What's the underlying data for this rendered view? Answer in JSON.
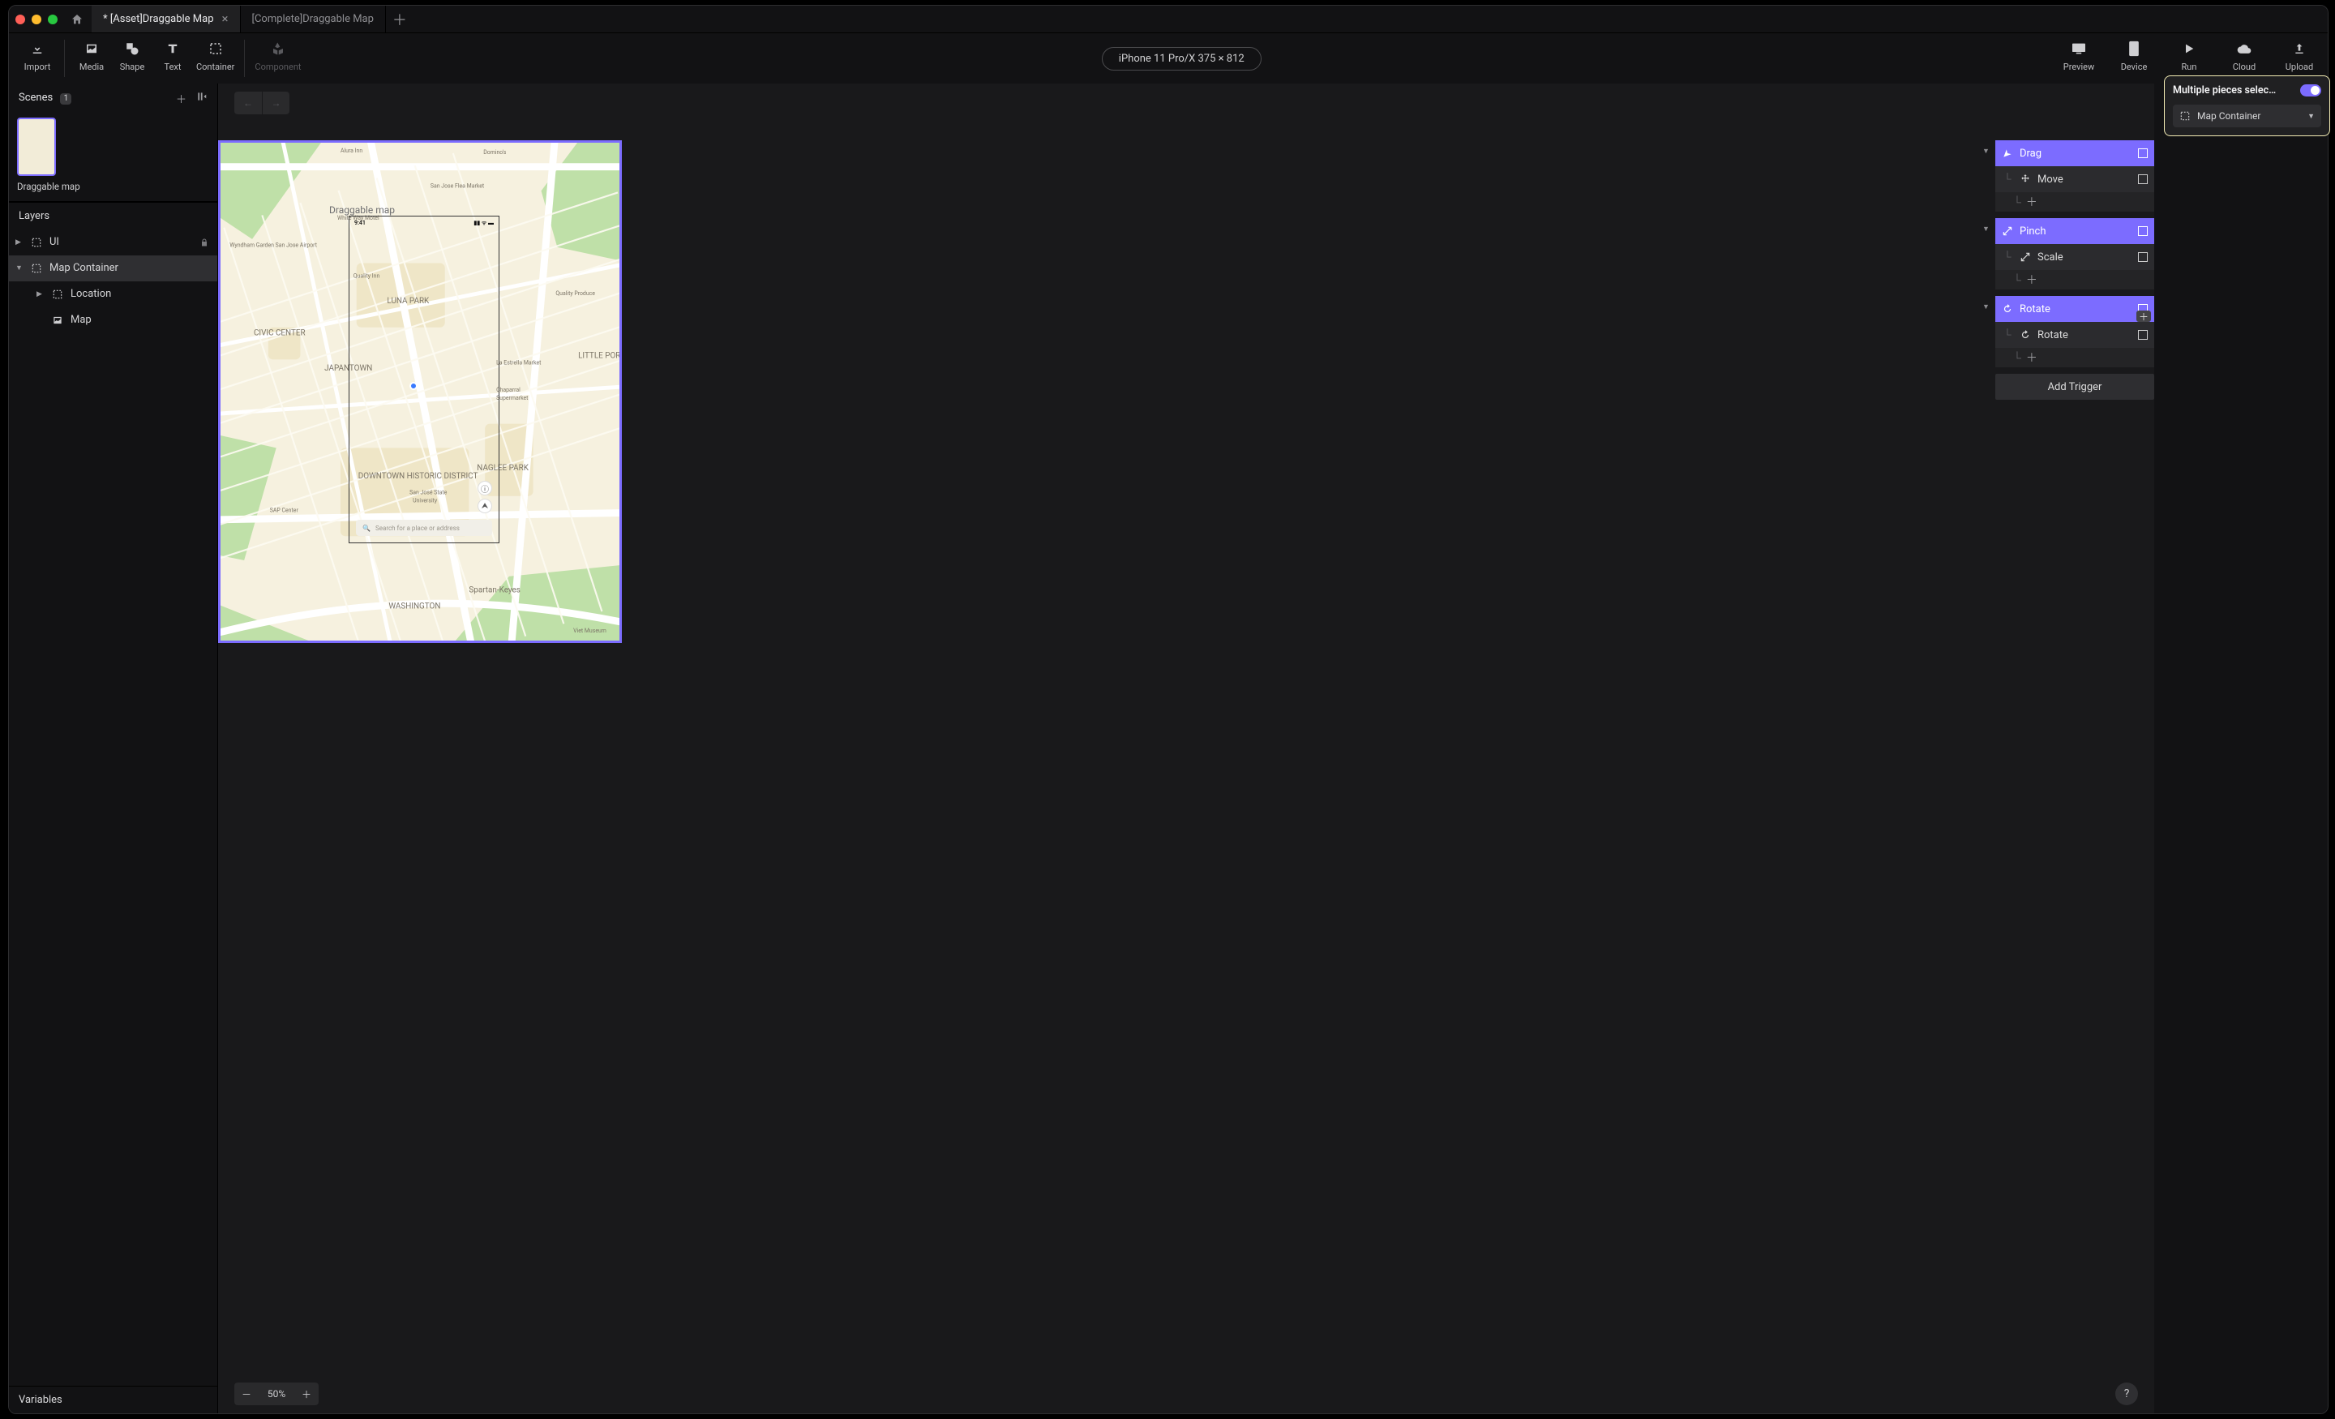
{
  "tabs": {
    "active": "* [Asset]Draggable Map",
    "inactive": "[Complete]Draggable Map"
  },
  "toolbar": {
    "import": "Import",
    "media": "Media",
    "shape": "Shape",
    "text": "Text",
    "container": "Container",
    "component": "Component",
    "preview": "Preview",
    "device": "Device",
    "run": "Run",
    "cloud": "Cloud",
    "upload": "Upload"
  },
  "device_pill": "iPhone 11 Pro/X  375 × 812",
  "scenes": {
    "title": "Scenes",
    "count": "1",
    "item": "Draggable map"
  },
  "layers": {
    "title": "Layers",
    "ui": "UI",
    "map_container": "Map Container",
    "location": "Location",
    "map": "Map"
  },
  "variables_title": "Variables",
  "zoom": "50%",
  "canvas_label": "Draggable map",
  "phone": {
    "time": "9:41",
    "search_ph": "Search for a place or address"
  },
  "triggers": {
    "drag": {
      "title": "Drag",
      "action": "Move"
    },
    "pinch": {
      "title": "Pinch",
      "action": "Scale"
    },
    "rotate": {
      "title": "Rotate",
      "action": "Rotate"
    },
    "add": "Add Trigger"
  },
  "inspector": {
    "title": "Multiple pieces selec…",
    "combo": "Map Container"
  },
  "map_text": {
    "aluraInn": "Alura Inn",
    "dominos": "Domino's",
    "flea": "San Jose Flea Market",
    "whitewaymotel": "White Way Motel",
    "wyndham": "Wyndham Garden San Jose Airport",
    "qualityinn": "Quality Inn",
    "lunapark": "LUNA PARK",
    "qualityprod": "Quality Produce",
    "civic": "CIVIC CENTER",
    "laestrella": "La Estrella Market",
    "littleportugal": "LITTLE PORTUGAL",
    "japantown": "JAPANTOWN",
    "chaparral1": "Chaparral",
    "chaparral2": "Supermarket",
    "sapcenter": "SAP Center",
    "downtown": "DOWNTOWN HISTORIC DISTRICT",
    "sjsu1": "San José State",
    "sjsu2": "University",
    "naglee": "NAGLEE PARK",
    "spartan": "Spartan-Keyes",
    "washington": "WASHINGTON",
    "viet": "Viet Museum"
  }
}
